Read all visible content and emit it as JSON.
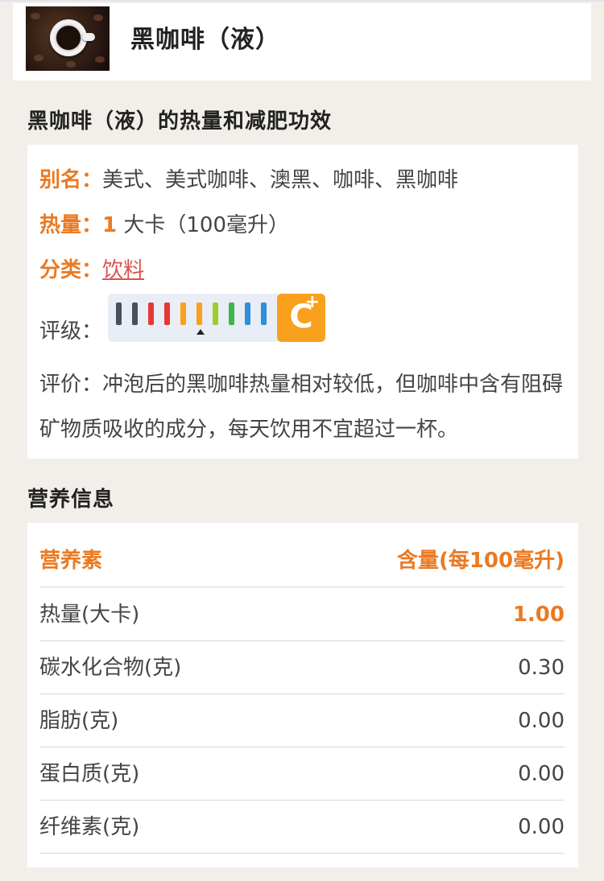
{
  "header": {
    "title": "黑咖啡（液）",
    "thumbnail_icon": "coffee-cup-image"
  },
  "effect_section": {
    "title": "黑咖啡（液）的热量和减肥功效"
  },
  "info": {
    "alias_label": "别名",
    "alias_value": "美式、美式咖啡、澳黑、咖啡、黑咖啡",
    "calorie_label": "热量",
    "calorie_number": "1",
    "calorie_unit": "大卡（100毫升）",
    "category_label": "分类",
    "category_value": "饮料",
    "rating_label": "评级",
    "rating_grade": "C",
    "rating_plus": "+",
    "rating_scale_colors": [
      "#4a4f5a",
      "#4a4f5a",
      "#e53935",
      "#e53935",
      "#f9a11d",
      "#f9a11d",
      "#9ccc2e",
      "#3fb54a",
      "#2f8fd8",
      "#2f8fd8"
    ],
    "review_label": "评价",
    "review_text": "冲泡后的黑咖啡热量相对较低，但咖啡中含有阻碍矿物质吸收的成分，每天饮用不宜超过一杯。"
  },
  "nutrition_section": {
    "title": "营养信息"
  },
  "nutrition_table": {
    "header_left": "营养素",
    "header_right": "含量(每100毫升)",
    "rows": [
      {
        "name": "热量(大卡)",
        "value": "1.00"
      },
      {
        "name": "碳水化合物(克)",
        "value": "0.30"
      },
      {
        "name": "脂肪(克)",
        "value": "0.00"
      },
      {
        "name": "蛋白质(克)",
        "value": "0.00"
      },
      {
        "name": "纤维素(克)",
        "value": "0.00"
      }
    ]
  },
  "colors": {
    "accent": "#ea7a23",
    "link": "#d9534f",
    "background": "#f2efea"
  }
}
